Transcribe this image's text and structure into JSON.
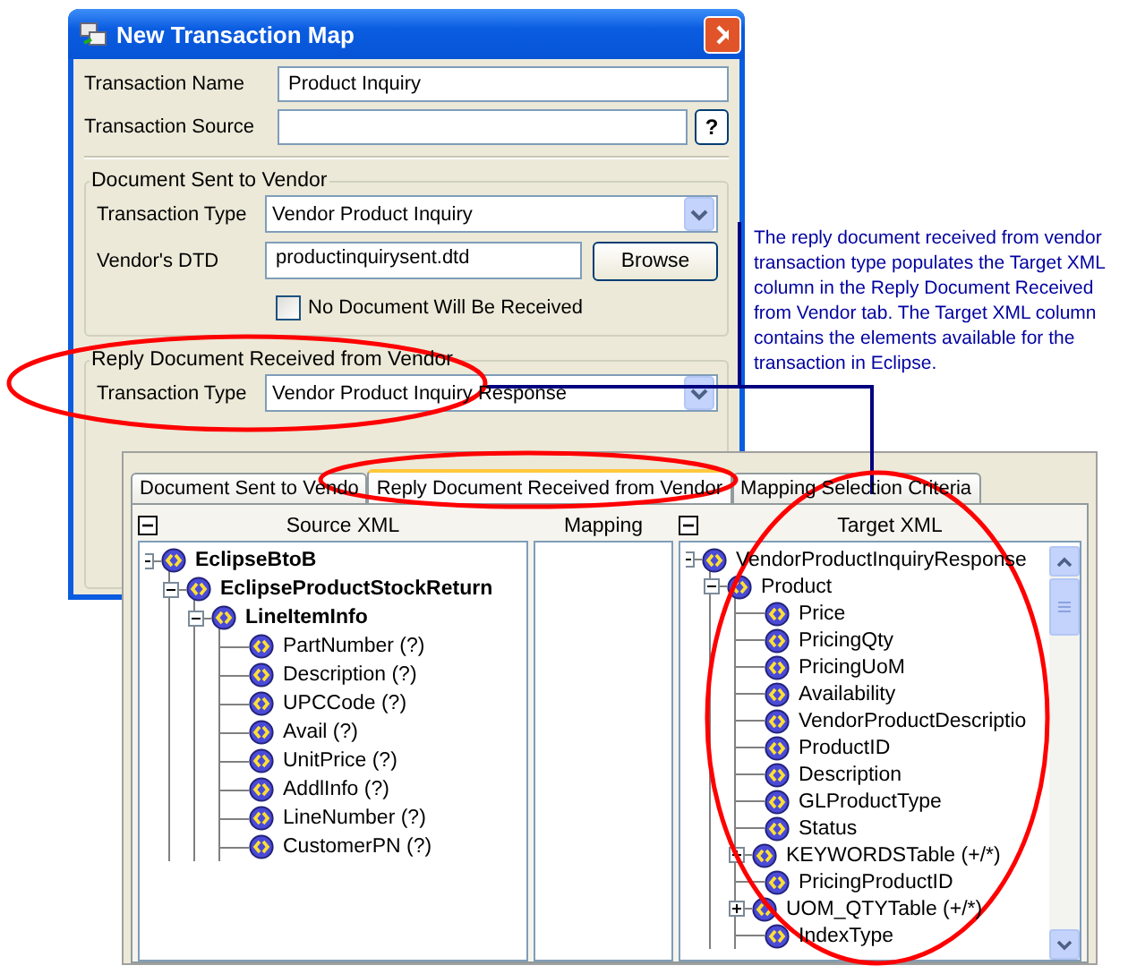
{
  "dialog": {
    "title": "New Transaction Map",
    "fields": [
      {
        "label": "Transaction Name",
        "value": "Product Inquiry"
      },
      {
        "label": "Transaction Source",
        "help_button": "?"
      }
    ],
    "sent_group": {
      "title": "Document Sent to Vendor",
      "transaction_type": {
        "label": "Transaction Type",
        "value": "Vendor Product Inquiry"
      },
      "dtd": {
        "label": "Vendor's DTD",
        "value": "productinquirysent.dtd",
        "button": "Browse"
      },
      "no_document": {
        "label": "No Document Will Be Received",
        "checked": false
      }
    },
    "reply_group": {
      "title": "Reply Document Received from Vendor",
      "transaction_type": {
        "label": "Transaction Type",
        "value": "Vendor Product Inquiry Response"
      }
    }
  },
  "callout": {
    "text": "The reply document received from vendor transaction type populates the Target XML column in the Reply Document Received from Vendor tab. The Target XML column contains the elements available for the transaction in Eclipse."
  },
  "mapper": {
    "tabs": [
      {
        "label": "Document Sent to Vendo",
        "selected": false
      },
      {
        "label": "Reply Document Received from Vendor",
        "selected": true
      },
      {
        "label": "Mapping Selection Criteria",
        "selected": false
      }
    ],
    "source": {
      "title": "Source XML",
      "tree": [
        {
          "label": "EclipseBtoB",
          "bold": true,
          "expanded": true,
          "children": [
            {
              "label": "EclipseProductStockReturn",
              "bold": true,
              "expanded": true,
              "children": [
                {
                  "label": "LineItemInfo",
                  "bold": true,
                  "expanded": true,
                  "children": [
                    {
                      "label": "PartNumber (?)",
                      "bold": false
                    },
                    {
                      "label": "Description (?)",
                      "bold": false
                    },
                    {
                      "label": "UPCCode (?)",
                      "bold": false
                    },
                    {
                      "label": "Avail (?)",
                      "bold": false
                    },
                    {
                      "label": "UnitPrice (?)",
                      "bold": false
                    },
                    {
                      "label": "AddlInfo (?)",
                      "bold": false
                    },
                    {
                      "label": "LineNumber (?)",
                      "bold": false
                    },
                    {
                      "label": "CustomerPN (?)",
                      "bold": false
                    }
                  ]
                }
              ]
            }
          ]
        }
      ]
    },
    "mapping": {
      "title": "Mapping"
    },
    "target": {
      "title": "Target XML",
      "tree": [
        {
          "label": "VendorProductInquiryResponse",
          "expanded": true,
          "children": [
            {
              "label": "Product",
              "expanded": true,
              "children": [
                {
                  "label": "Price"
                },
                {
                  "label": "PricingQty"
                },
                {
                  "label": "PricingUoM"
                },
                {
                  "label": "Availability"
                },
                {
                  "label": "VendorProductDescriptio"
                },
                {
                  "label": "ProductID"
                },
                {
                  "label": "Description"
                },
                {
                  "label": "GLProductType"
                },
                {
                  "label": "Status"
                },
                {
                  "label": "KEYWORDSTable (+/*)",
                  "expanded": false
                },
                {
                  "label": "PricingProductID"
                },
                {
                  "label": "UOM_QTYTable (+/*)",
                  "expanded": false
                },
                {
                  "label": "IndexType"
                }
              ]
            }
          ]
        }
      ]
    }
  }
}
